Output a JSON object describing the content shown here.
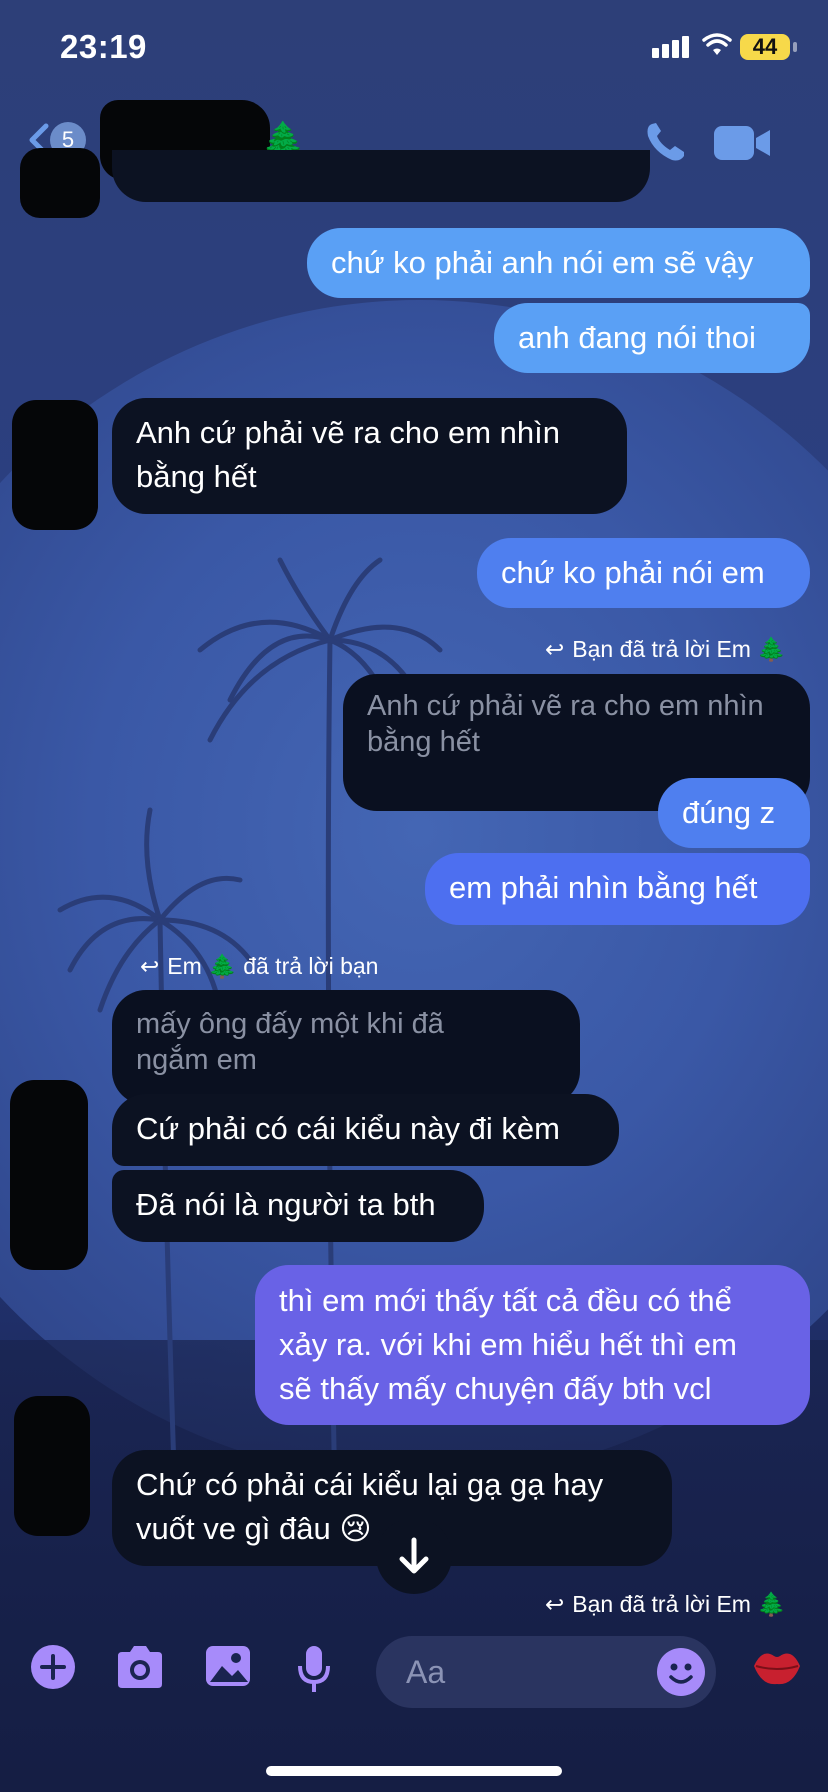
{
  "status_bar": {
    "time": "23:19",
    "battery": "44"
  },
  "header": {
    "back_count": "5",
    "name_emoji": "🌲"
  },
  "messages": [
    {
      "id": "m1",
      "text": "chứ ko phải anh nói em sẽ vậy"
    },
    {
      "id": "m2",
      "text": "anh đang nói thoi"
    },
    {
      "id": "m3",
      "line1": "Anh cứ phải vẽ ra cho em nhìn",
      "line2": "bằng hết"
    },
    {
      "id": "m4",
      "text": "chứ ko phải nói em"
    },
    {
      "id": "m5",
      "text": "đúng z"
    },
    {
      "id": "m6",
      "text": "em phải nhìn bằng hết"
    },
    {
      "id": "m7",
      "text": "Cứ phải có cái kiểu này đi kèm"
    },
    {
      "id": "m8",
      "text": "Đã nói là người ta bth"
    },
    {
      "id": "m9",
      "line1": "thì em mới thấy tất cả đều có thể",
      "line2": "xảy ra. với khi em hiểu hết thì em",
      "line3": "sẽ thấy mấy chuyện đấy bth vcl"
    },
    {
      "id": "m10",
      "line1": "Chứ có phải cái kiểu lại gạ gạ hay",
      "line2": "vuốt ve gì đâu 😢"
    }
  ],
  "replies": {
    "r1": {
      "label": "Bạn đã trả lời Em 🌲",
      "quote_line1": "Anh cứ phải vẽ ra cho em nhìn",
      "quote_line2": "bằng hết"
    },
    "r2": {
      "label": "Em 🌲  đã trả lời bạn",
      "quote_line1": "mấy ông đấy một khi đã",
      "quote_line2": "ngắm em"
    },
    "r3": {
      "label": "Bạn đã trả lời Em 🌲"
    }
  },
  "composer": {
    "placeholder": "Aa"
  },
  "icons": {
    "add": "plus-circle-icon",
    "camera": "camera-icon",
    "gallery": "image-icon",
    "mic": "microphone-icon",
    "emoji": "smiley-icon",
    "reaction": "lips-kiss-icon",
    "call": "phone-icon",
    "video": "video-camera-icon",
    "scroll": "arrow-down-icon"
  },
  "colors": {
    "accent": "#a78bfa",
    "out_light": "#5aa0f5",
    "out_mid": "#4f7fef",
    "out_violet": "#6962e6",
    "incoming": "#0c1222"
  }
}
